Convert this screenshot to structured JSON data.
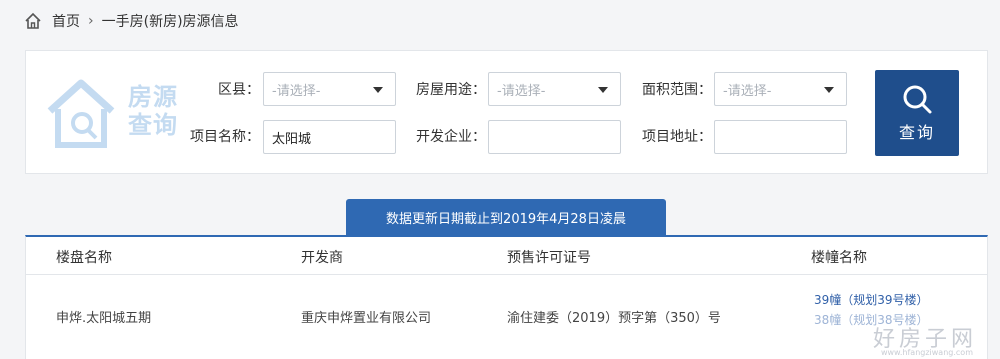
{
  "breadcrumb": {
    "home": "首页",
    "current": "一手房(新房)房源信息"
  },
  "logo": {
    "line1": "房源",
    "line2": "查询"
  },
  "filters": {
    "district_label": "区县：",
    "district_placeholder": "-请选择-",
    "usage_label": "房屋用途：",
    "usage_placeholder": "-请选择-",
    "area_label": "面积范围：",
    "area_placeholder": "-请选择-",
    "project_name_label": "项目名称：",
    "project_name_value": "太阳城",
    "developer_label": "开发企业：",
    "developer_value": "",
    "address_label": "项目地址：",
    "address_value": ""
  },
  "search_button": {
    "label": "查询"
  },
  "notice": "数据更新日期截止到2019年4月28日凌晨",
  "table": {
    "headers": [
      "楼盘名称",
      "开发商",
      "预售许可证号",
      "楼幢名称"
    ],
    "rows": [
      {
        "project": "申烨.太阳城五期",
        "developer": "重庆申烨置业有限公司",
        "permit": "渝住建委（2019）预字第（350）号",
        "buildings": [
          "39幢（规划39号楼）",
          "38幢（规划38号楼）"
        ]
      }
    ]
  },
  "watermark": {
    "text": "好房子网",
    "url": "www.hfangziwang.com"
  },
  "colors": {
    "primary": "#1f4e8c",
    "accent": "#2f69b3",
    "logo": "#c4dbf1"
  }
}
